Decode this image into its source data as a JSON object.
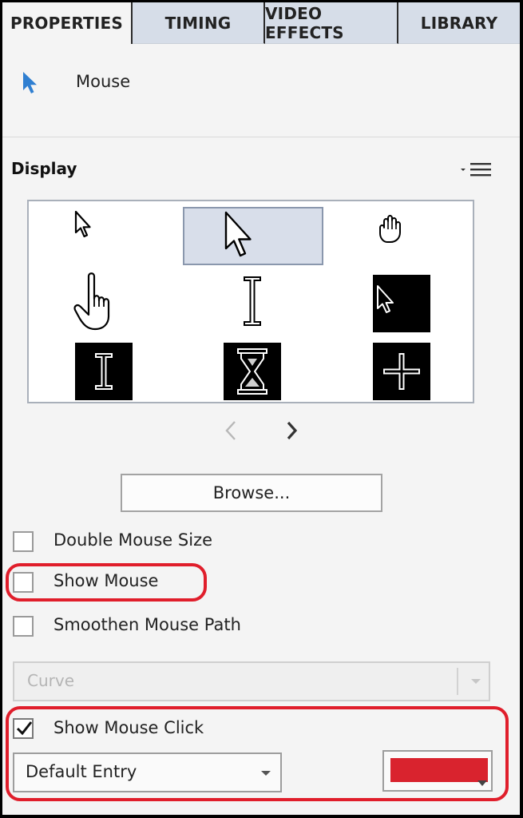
{
  "tabs": [
    {
      "label": "PROPERTIES",
      "active": true
    },
    {
      "label": "TIMING",
      "active": false
    },
    {
      "label": "VIDEO EFFECTS",
      "active": false
    },
    {
      "label": "LIBRARY",
      "active": false
    }
  ],
  "header": {
    "title": "Mouse",
    "icon": "arrow-cursor-icon",
    "icon_color": "#2f7fd1"
  },
  "display": {
    "title": "Display",
    "menu_icon": "options-menu-icon",
    "cursors": [
      "arrow-cursor",
      "arrow-cursor-large",
      "hand-grab-cursor",
      "hand-pointer-cursor",
      "ibeam-cursor",
      "arrow-cursor-inverted",
      "ibeam-cursor-inverted",
      "hourglass-cursor",
      "crosshair-cursor"
    ],
    "selected_index": 1,
    "nav_prev_icon": "chevron-left-icon",
    "nav_next_icon": "chevron-right-icon",
    "browse_label": "Browse..."
  },
  "options": {
    "double_mouse_size": {
      "label": "Double Mouse Size",
      "checked": false
    },
    "show_mouse": {
      "label": "Show Mouse",
      "checked": false
    },
    "smoothen_mouse_path": {
      "label": "Smoothen Mouse Path",
      "checked": false
    },
    "path_style": {
      "value": "Curve",
      "enabled": false
    },
    "show_mouse_click": {
      "label": "Show Mouse Click",
      "checked": true
    },
    "click_style": {
      "value": "Default Entry"
    },
    "click_color": "#d9232e"
  },
  "colors": {
    "highlight": "#e01e2b",
    "accent": "#2f7fd1"
  }
}
